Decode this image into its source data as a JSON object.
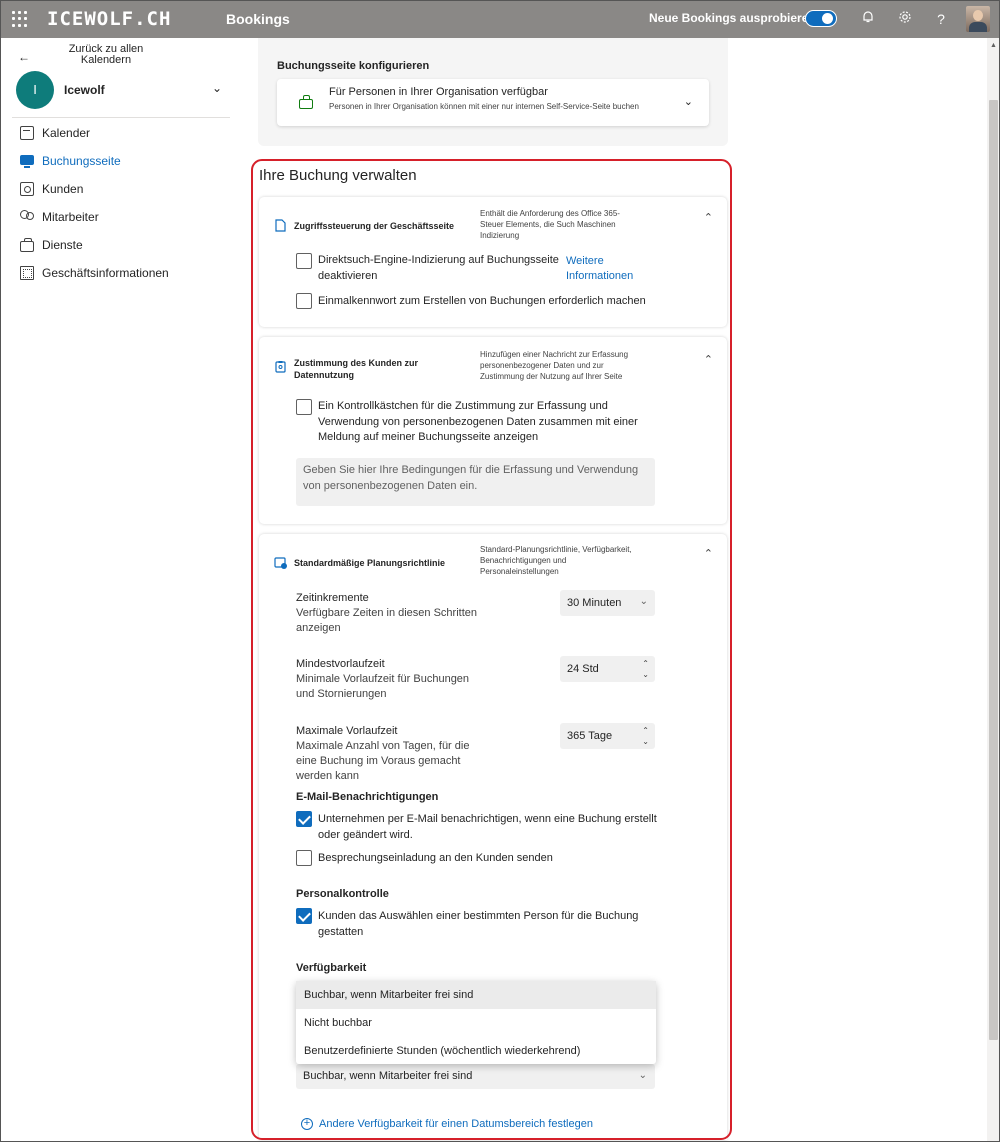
{
  "topbar": {
    "brand": "ICEWOLF.CH",
    "app": "Bookings",
    "try_new": "Neue Bookings ausprobieren",
    "toggle_on": true,
    "icons": [
      "waffle-icon",
      "bell-icon",
      "gear-icon",
      "help-icon",
      "avatar"
    ]
  },
  "sidebar": {
    "back_label": "Zurück zu allen Kalendern",
    "org_initial": "I",
    "org_name": "Icewolf",
    "items": [
      {
        "label": "Kalender",
        "icon": "calendar-icon",
        "active": false
      },
      {
        "label": "Buchungsseite",
        "icon": "booking-page-icon",
        "active": true
      },
      {
        "label": "Kunden",
        "icon": "customers-icon",
        "active": false
      },
      {
        "label": "Mitarbeiter",
        "icon": "staff-icon",
        "active": false
      },
      {
        "label": "Dienste",
        "icon": "services-icon",
        "active": false
      },
      {
        "label": "Geschäftsinformationen",
        "icon": "business-info-icon",
        "active": false
      }
    ]
  },
  "configure": {
    "label": "Buchungsseite konfigurieren",
    "selected_title": "Für Personen in Ihrer Organisation verfügbar",
    "selected_desc": "Personen in Ihrer Organisation können mit einer nur internen Self-Service-Seite buchen"
  },
  "manage": {
    "title": "Ihre Buchung verwalten",
    "access": {
      "title": "Zugriffssteuerung der Geschäftsseite",
      "desc": "Enthält die Anforderung des Office 365-Steuer Elements, die Such Maschinen Indizierung",
      "opt1": "Direktsuch-Engine-Indizierung auf Buchungsseite deaktivieren",
      "opt1_checked": false,
      "more_info": "Weitere Informationen",
      "opt2": "Einmalkennwort zum Erstellen von Buchungen erforderlich machen",
      "opt2_checked": false
    },
    "consent": {
      "title": "Zustimmung des Kunden zur Datennutzung",
      "desc": "Hinzufügen einer Nachricht zur Erfassung personenbezogener Daten und zur Zustimmung der Nutzung auf Ihrer Seite",
      "opt": "Ein Kontrollkästchen für die Zustimmung zur Erfassung und Verwendung von personenbezogenen Daten zusammen mit einer Meldung auf meiner Buchungsseite anzeigen",
      "opt_checked": false,
      "placeholder": "Geben Sie hier Ihre Bedingungen für die Erfassung und Verwendung von personenbezogenen Daten ein."
    },
    "policy": {
      "title": "Standardmäßige Planungsrichtlinie",
      "desc": "Standard-Planungsrichtlinie, Verfügbarkeit, Benachrichtigungen und Personaleinstellungen",
      "increments_label": "Zeitinkremente",
      "increments_sub": "Verfügbare Zeiten in diesen Schritten anzeigen",
      "increments_value": "30 Minuten",
      "min_lead_label": "Mindestvorlaufzeit",
      "min_lead_sub": "Minimale Vorlaufzeit für Buchungen und Stornierungen",
      "min_lead_value": "24 Std",
      "max_lead_label": "Maximale Vorlaufzeit",
      "max_lead_sub": "Maximale Anzahl von Tagen, für die eine Buchung im Voraus gemacht werden kann",
      "max_lead_value": "365 Tage",
      "email_heading": "E-Mail-Benachrichtigungen",
      "email_opt1": "Unternehmen per E-Mail benachrichtigen, wenn eine Buchung erstellt oder geändert wird.",
      "email_opt1_checked": true,
      "email_opt2": "Besprechungseinladung an den Kunden senden",
      "email_opt2_checked": false,
      "staff_heading": "Personalkontrolle",
      "staff_opt": "Kunden das Auswählen einer bestimmten Person für die Buchung gestatten",
      "staff_opt_checked": true,
      "avail_heading": "Verfügbarkeit",
      "avail_options": [
        "Buchbar, wenn Mitarbeiter frei sind",
        "Nicht buchbar",
        "Benutzerdefinierte Stunden (wöchentlich wiederkehrend)"
      ],
      "avail_selected": "Buchbar, wenn Mitarbeiter frei sind",
      "add_range": "Andere Verfügbarkeit für einen Datumsbereich festlegen"
    }
  },
  "colors": {
    "accent": "#0f6cbd",
    "topbar": "#8a8886",
    "highlight_border": "#d6202a",
    "org_avatar": "#0e7c7b"
  }
}
